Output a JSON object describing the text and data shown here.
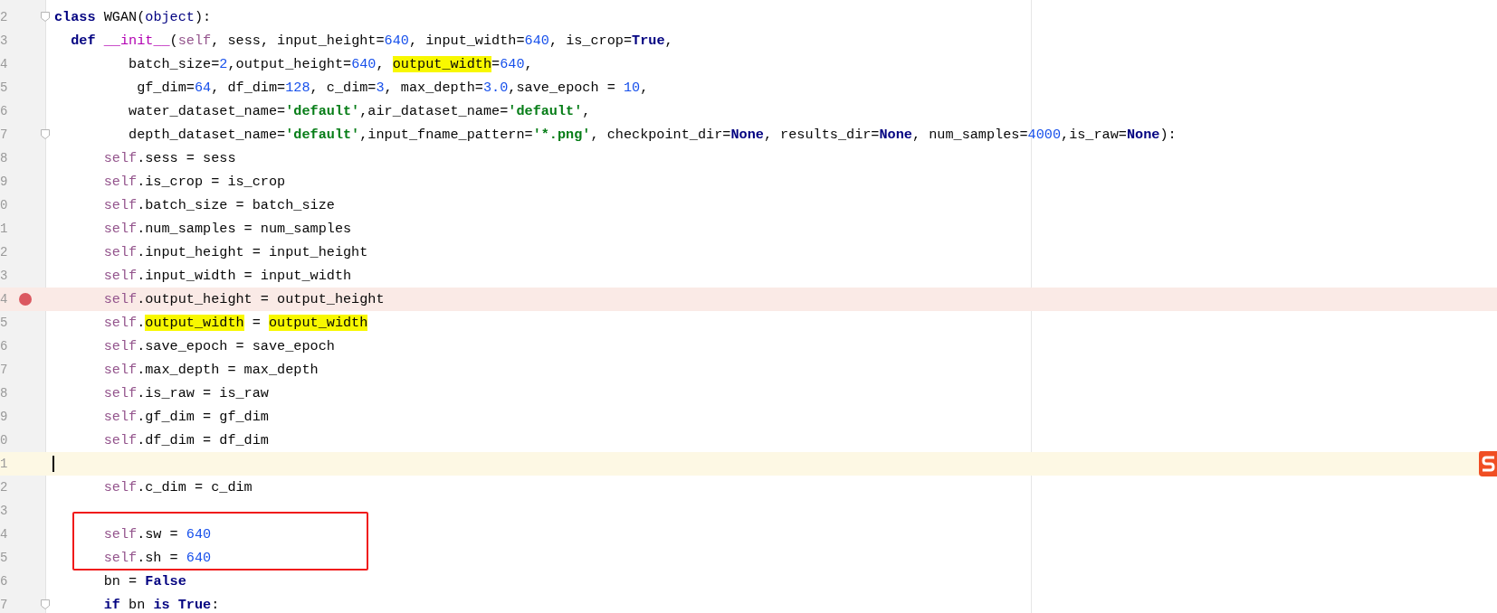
{
  "editor": {
    "lines": [
      {
        "number": "2",
        "fold": true,
        "tokens": [
          {
            "t": "class",
            "kind": "kw"
          },
          {
            "t": " WGAN(",
            "kind": "p"
          },
          {
            "t": "object",
            "kind": "bi"
          },
          {
            "t": "):",
            "kind": "p"
          }
        ]
      },
      {
        "number": "3",
        "tokens": [
          {
            "t": "  def",
            "kind": "kw"
          },
          {
            "t": " __init__",
            "kind": "magic"
          },
          {
            "t": "(",
            "kind": "p"
          },
          {
            "t": "self",
            "kind": "self"
          },
          {
            "t": ", sess, input_height=",
            "kind": "p"
          },
          {
            "t": "640",
            "kind": "num"
          },
          {
            "t": ", input_width=",
            "kind": "p"
          },
          {
            "t": "640",
            "kind": "num"
          },
          {
            "t": ", is_crop=",
            "kind": "p"
          },
          {
            "t": "True",
            "kind": "kw"
          },
          {
            "t": ",",
            "kind": "p"
          }
        ]
      },
      {
        "number": "4",
        "tokens": [
          {
            "t": "         batch_size=",
            "kind": "p"
          },
          {
            "t": "2",
            "kind": "num"
          },
          {
            "t": ",output_height=",
            "kind": "p"
          },
          {
            "t": "640",
            "kind": "num"
          },
          {
            "t": ", ",
            "kind": "p"
          },
          {
            "t": "output_width",
            "kind": "hl"
          },
          {
            "t": "=",
            "kind": "p"
          },
          {
            "t": "640",
            "kind": "num"
          },
          {
            "t": ",",
            "kind": "p"
          }
        ]
      },
      {
        "number": "5",
        "tokens": [
          {
            "t": "          gf_dim=",
            "kind": "p"
          },
          {
            "t": "64",
            "kind": "num"
          },
          {
            "t": ", df_dim=",
            "kind": "p"
          },
          {
            "t": "128",
            "kind": "num"
          },
          {
            "t": ", c_dim=",
            "kind": "p"
          },
          {
            "t": "3",
            "kind": "num"
          },
          {
            "t": ", max_depth=",
            "kind": "p"
          },
          {
            "t": "3.0",
            "kind": "num"
          },
          {
            "t": ",save_epoch = ",
            "kind": "p"
          },
          {
            "t": "10",
            "kind": "num"
          },
          {
            "t": ",",
            "kind": "p"
          }
        ]
      },
      {
        "number": "6",
        "tokens": [
          {
            "t": "         water_dataset_name=",
            "kind": "p"
          },
          {
            "t": "'default'",
            "kind": "str"
          },
          {
            "t": ",air_dataset_name=",
            "kind": "p"
          },
          {
            "t": "'default'",
            "kind": "str"
          },
          {
            "t": ",",
            "kind": "p"
          }
        ]
      },
      {
        "number": "7",
        "fold": true,
        "tokens": [
          {
            "t": "         depth_dataset_name=",
            "kind": "p"
          },
          {
            "t": "'default'",
            "kind": "str"
          },
          {
            "t": ",input_fname_pattern=",
            "kind": "p"
          },
          {
            "t": "'*.png'",
            "kind": "str"
          },
          {
            "t": ", checkpoint_dir=",
            "kind": "p"
          },
          {
            "t": "None",
            "kind": "kw"
          },
          {
            "t": ", results_dir=",
            "kind": "p"
          },
          {
            "t": "None",
            "kind": "kw"
          },
          {
            "t": ", num_samples=",
            "kind": "p"
          },
          {
            "t": "4000",
            "kind": "num"
          },
          {
            "t": ",is_raw=",
            "kind": "p"
          },
          {
            "t": "None",
            "kind": "kw"
          },
          {
            "t": "):",
            "kind": "p"
          }
        ]
      },
      {
        "number": "8",
        "tokens": [
          {
            "t": "      self",
            "kind": "self"
          },
          {
            "t": ".sess = sess",
            "kind": "p"
          }
        ]
      },
      {
        "number": "9",
        "tokens": [
          {
            "t": "      self",
            "kind": "self"
          },
          {
            "t": ".is_crop = is_crop",
            "kind": "p"
          }
        ]
      },
      {
        "number": "0",
        "tokens": [
          {
            "t": "      self",
            "kind": "self"
          },
          {
            "t": ".batch_size = batch_size",
            "kind": "p"
          }
        ]
      },
      {
        "number": "1",
        "tokens": [
          {
            "t": "      self",
            "kind": "self"
          },
          {
            "t": ".num_samples = num_samples",
            "kind": "p"
          }
        ]
      },
      {
        "number": "2",
        "tokens": [
          {
            "t": "      self",
            "kind": "self"
          },
          {
            "t": ".input_height = input_height",
            "kind": "p"
          }
        ]
      },
      {
        "number": "3",
        "tokens": [
          {
            "t": "      self",
            "kind": "self"
          },
          {
            "t": ".input_width = input_width",
            "kind": "p"
          }
        ]
      },
      {
        "number": "4",
        "breakpoint": true,
        "tokens": [
          {
            "t": "      self",
            "kind": "self"
          },
          {
            "t": ".output_height = output_height",
            "kind": "p"
          }
        ]
      },
      {
        "number": "5",
        "tokens": [
          {
            "t": "      self",
            "kind": "self"
          },
          {
            "t": ".",
            "kind": "p"
          },
          {
            "t": "output_width",
            "kind": "hl"
          },
          {
            "t": " = ",
            "kind": "p"
          },
          {
            "t": "output_width",
            "kind": "hl"
          }
        ]
      },
      {
        "number": "6",
        "tokens": [
          {
            "t": "      self",
            "kind": "self"
          },
          {
            "t": ".save_epoch = save_epoch",
            "kind": "p"
          }
        ]
      },
      {
        "number": "7",
        "tokens": [
          {
            "t": "      self",
            "kind": "self"
          },
          {
            "t": ".max_depth = max_depth",
            "kind": "p"
          }
        ]
      },
      {
        "number": "8",
        "tokens": [
          {
            "t": "      self",
            "kind": "self"
          },
          {
            "t": ".is_raw = is_raw",
            "kind": "p"
          }
        ]
      },
      {
        "number": "9",
        "tokens": [
          {
            "t": "      self",
            "kind": "self"
          },
          {
            "t": ".gf_dim = gf_dim",
            "kind": "p"
          }
        ]
      },
      {
        "number": "0",
        "tokens": [
          {
            "t": "      self",
            "kind": "self"
          },
          {
            "t": ".df_dim = df_dim",
            "kind": "p"
          }
        ]
      },
      {
        "number": "1",
        "current": true
      },
      {
        "number": "2",
        "tokens": [
          {
            "t": "      self",
            "kind": "self"
          },
          {
            "t": ".c_dim = c_dim",
            "kind": "p"
          }
        ]
      },
      {
        "number": "3"
      },
      {
        "number": "4",
        "boxed": true,
        "tokens": [
          {
            "t": "      self",
            "kind": "self"
          },
          {
            "t": ".sw = ",
            "kind": "p"
          },
          {
            "t": "640",
            "kind": "num"
          }
        ]
      },
      {
        "number": "5",
        "boxed": true,
        "tokens": [
          {
            "t": "      self",
            "kind": "self"
          },
          {
            "t": ".sh = ",
            "kind": "p"
          },
          {
            "t": "640",
            "kind": "num"
          }
        ]
      },
      {
        "number": "6",
        "tokens": [
          {
            "t": "      bn = ",
            "kind": "p"
          },
          {
            "t": "False",
            "kind": "kw"
          }
        ]
      },
      {
        "number": "7",
        "fold": true,
        "tokens": [
          {
            "t": "      if",
            "kind": "kw"
          },
          {
            "t": " bn ",
            "kind": "p"
          },
          {
            "t": "is",
            "kind": "kw"
          },
          {
            "t": " True",
            "kind": "kw"
          },
          {
            "t": ":",
            "kind": "p"
          }
        ]
      }
    ]
  }
}
